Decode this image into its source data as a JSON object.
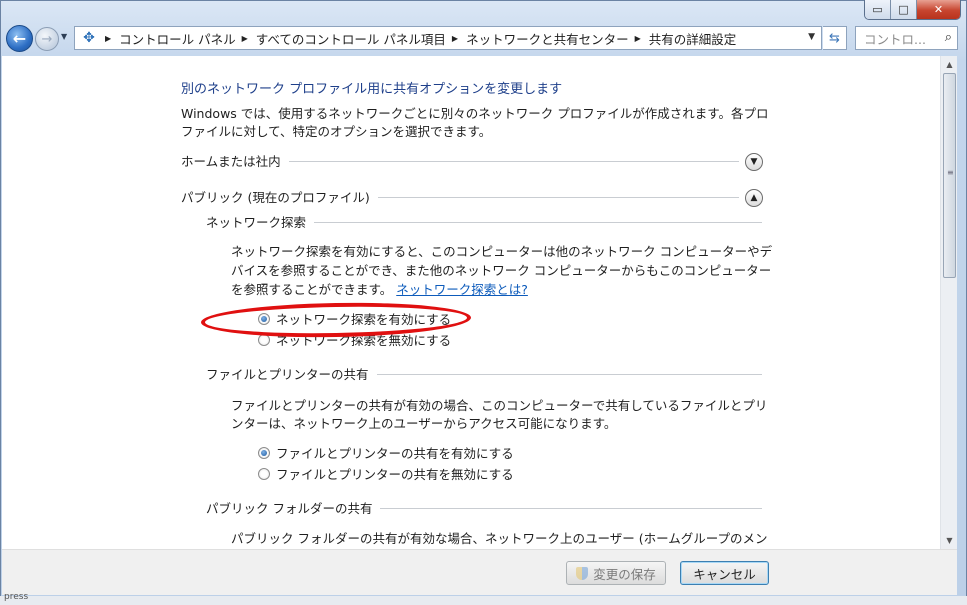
{
  "window": {
    "minimize": "▭",
    "maximize": "□",
    "close": "✕"
  },
  "nav": {
    "back_icon": "arrow-left-icon",
    "forward_icon": "arrow-right-icon",
    "address_icon": "network-icon",
    "breadcrumbs": [
      "コントロール パネル",
      "すべてのコントロール パネル項目",
      "ネットワークと共有センター",
      "共有の詳細設定"
    ],
    "search_placeholder": "コントロ..."
  },
  "content": {
    "title": "別のネットワーク プロファイル用に共有オプションを変更します",
    "intro_line1": "Windows では、使用するネットワークごとに別々のネットワーク プロファイルが作成されます。各プロ",
    "intro_line2": "ファイルに対して、特定のオプションを選択できます。",
    "profiles": [
      {
        "label": "ホームまたは社内",
        "expanded": false
      },
      {
        "label": "パブリック (現在のプロファイル)",
        "expanded": true
      }
    ],
    "network_discovery": {
      "heading": "ネットワーク探索",
      "desc_line1": "ネットワーク探索を有効にすると、このコンピューターは他のネットワーク コンピューターやデ",
      "desc_line2": "バイスを参照することができ、また他のネットワーク コンピューターからもこのコンピューター",
      "desc_line3": "を参照することができます。",
      "link": "ネットワーク探索とは?",
      "options": [
        {
          "label": "ネットワーク探索を有効にする",
          "selected": true
        },
        {
          "label": "ネットワーク探索を無効にする",
          "selected": false
        }
      ]
    },
    "file_printer": {
      "heading": "ファイルとプリンターの共有",
      "desc_line1": "ファイルとプリンターの共有が有効の場合、このコンピューターで共有しているファイルとプリ",
      "desc_line2": "ンターは、ネットワーク上のユーザーからアクセス可能になります。",
      "options": [
        {
          "label": "ファイルとプリンターの共有を有効にする",
          "selected": true
        },
        {
          "label": "ファイルとプリンターの共有を無効にする",
          "selected": false
        }
      ]
    },
    "public_folder": {
      "heading": "パブリック フォルダーの共有",
      "desc_line1": "パブリック フォルダーの共有が有効な場合、ネットワーク上のユーザー (ホームグループのメン"
    }
  },
  "footer": {
    "save_label": "変更の保存",
    "cancel_label": "キャンセル"
  },
  "status": {
    "text": "press"
  },
  "colors": {
    "heading": "#1e3f8a",
    "link": "#0d5bbb",
    "annotation": "#e01010"
  }
}
